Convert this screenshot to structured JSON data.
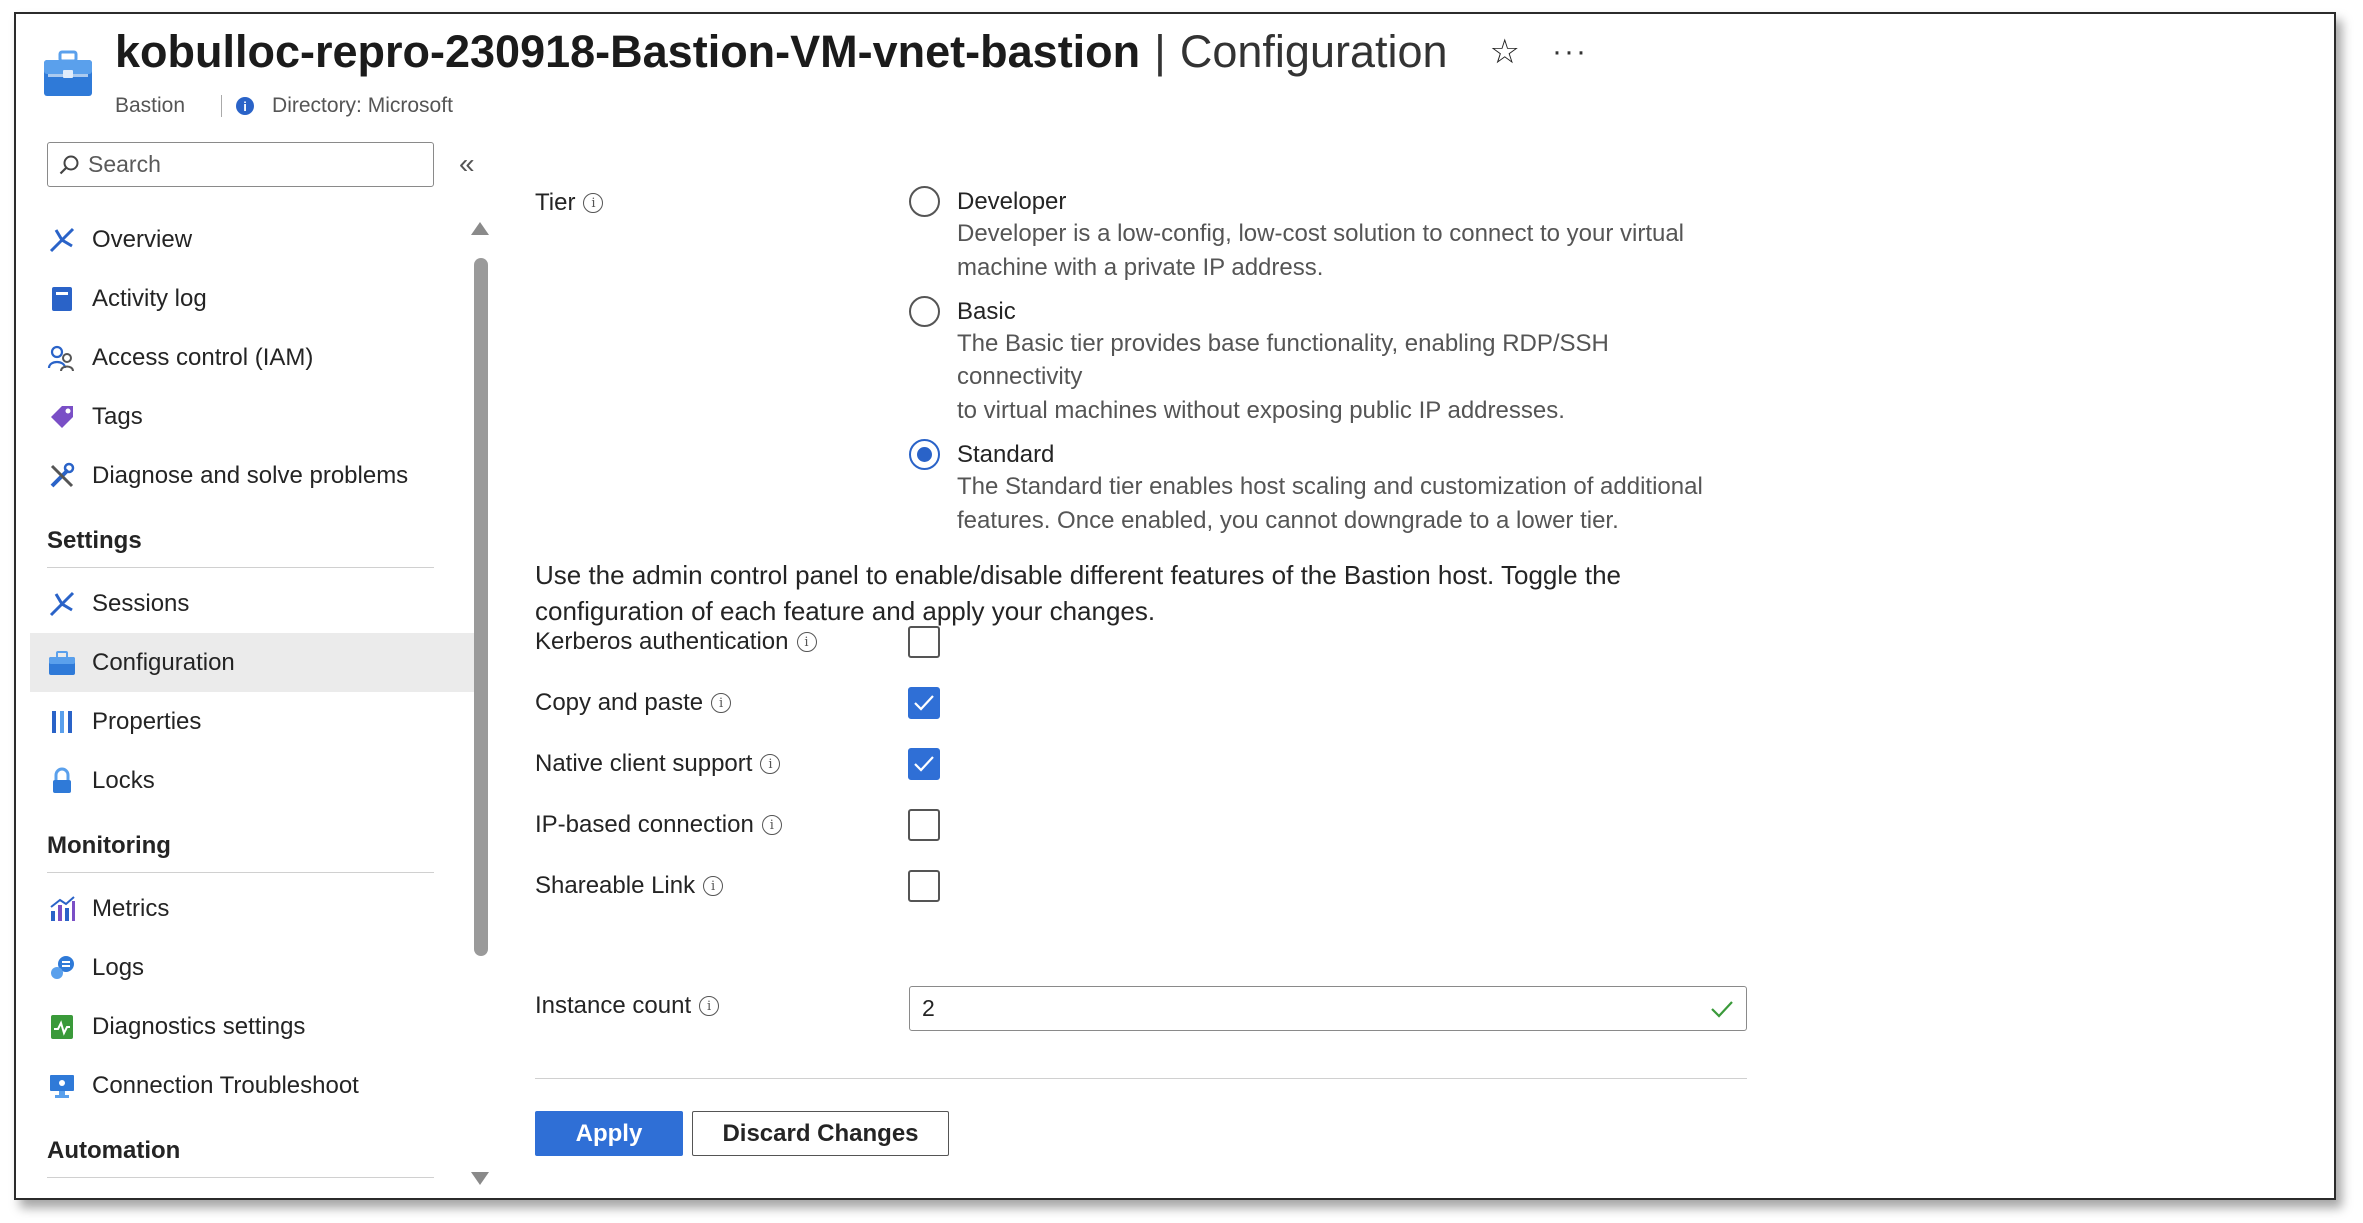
{
  "header": {
    "title": "kobulloc-repro-230918-Bastion-VM-vnet-bastion",
    "separator": "|",
    "subtitle": "Configuration",
    "resource_type": "Bastion",
    "directory": "Directory: Microsoft",
    "star_glyph": "☆",
    "more_glyph": "···"
  },
  "sidebar": {
    "search_placeholder": "Search",
    "collapse_glyph": "«",
    "items": [
      {
        "label": "Overview",
        "icon": "overview-icon"
      },
      {
        "label": "Activity log",
        "icon": "activity-log-icon"
      },
      {
        "label": "Access control (IAM)",
        "icon": "iam-icon"
      },
      {
        "label": "Tags",
        "icon": "tag-icon"
      },
      {
        "label": "Diagnose and solve problems",
        "icon": "wrench-icon"
      }
    ],
    "settings_heading": "Settings",
    "settings_items": [
      {
        "label": "Sessions",
        "icon": "sessions-icon"
      },
      {
        "label": "Configuration",
        "icon": "configuration-icon",
        "active": true
      },
      {
        "label": "Properties",
        "icon": "properties-icon"
      },
      {
        "label": "Locks",
        "icon": "lock-icon"
      }
    ],
    "monitoring_heading": "Monitoring",
    "monitoring_items": [
      {
        "label": "Metrics",
        "icon": "metrics-icon"
      },
      {
        "label": "Logs",
        "icon": "logs-icon"
      },
      {
        "label": "Diagnostics settings",
        "icon": "diagnostics-icon"
      },
      {
        "label": "Connection Troubleshoot",
        "icon": "monitor-icon"
      }
    ],
    "automation_heading": "Automation"
  },
  "tier": {
    "label": "Tier",
    "options": [
      {
        "name": "Developer",
        "desc1": "Developer is a low-config, low-cost solution to connect to your virtual",
        "desc2": "machine with a private IP address.",
        "selected": false
      },
      {
        "name": "Basic",
        "desc1": "The Basic tier provides base functionality, enabling RDP/SSH connectivity",
        "desc2": "to virtual machines without exposing public IP addresses.",
        "selected": false
      },
      {
        "name": "Standard",
        "desc1": "The Standard tier enables host scaling and customization of additional",
        "desc2": "features. Once enabled, you cannot downgrade to a lower tier.",
        "selected": true
      }
    ]
  },
  "intro": {
    "line1": "Use the admin control panel to enable/disable different features of the Bastion host. Toggle the",
    "line2": "configuration of each feature and apply your changes."
  },
  "features": [
    {
      "label": "Kerberos authentication",
      "checked": false
    },
    {
      "label": "Copy and paste",
      "checked": true
    },
    {
      "label": "Native client support",
      "checked": true
    },
    {
      "label": "IP-based connection",
      "checked": false
    },
    {
      "label": "Shareable Link",
      "checked": false
    }
  ],
  "instance_count": {
    "label": "Instance count",
    "value": "2"
  },
  "buttons": {
    "apply": "Apply",
    "discard": "Discard Changes"
  },
  "colors": {
    "accent": "#2f6fd6",
    "valid": "#3a9a3a"
  }
}
